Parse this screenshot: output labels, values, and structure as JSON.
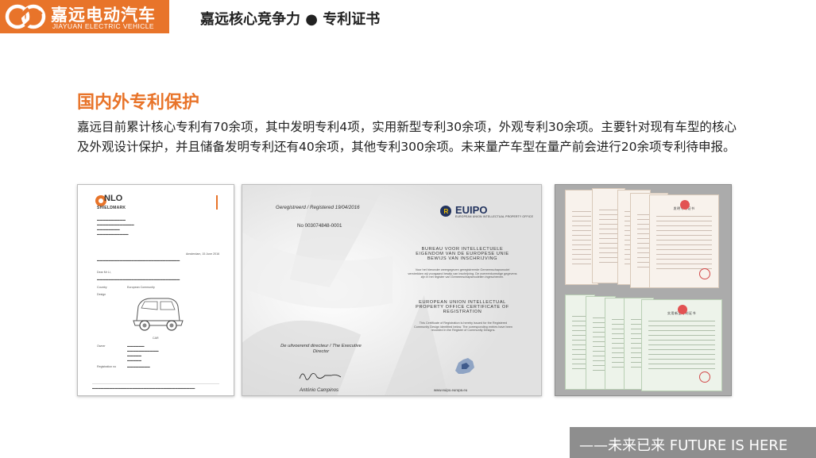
{
  "header": {
    "brand_cn": "嘉远电动汽车",
    "brand_en": "JIAYUAN ELECTRIC VEHICLE",
    "title": "嘉远核心竞争力  ●  专利证书",
    "brand_color": "#e8742a"
  },
  "section": {
    "title": "国内外专利保护",
    "body": "嘉远目前累计核心专利有70余项，其中发明专利4项，实用新型专利30余项，外观专利30余项。主要针对现有车型的核心及外观设计保护，并且储备发明专利还有40余项，其他专利300余项。未来量产车型在量产前会进行20余项专利待申报。"
  },
  "certificates": {
    "nlo": {
      "logo": "NLO",
      "logo_sub": "SHIELDMARK",
      "car_label": "CAR",
      "country_label": "Country",
      "country_value": "European Community",
      "design_label": "Design",
      "owner_label": "Owner",
      "registration_label": "Registration no",
      "date_line": "Amsterdam, 15 June 2016",
      "dear": "Dear Mr Li,"
    },
    "euipo": {
      "logo": "EUIPO",
      "logo_sub": "EUROPEAN UNION INTELLECTUAL PROPERTY OFFICE",
      "registered": "Geregistreerd / Registered 19/04/2016",
      "number": "No 003074848-0001",
      "bureau": "BUREAU VOOR INTELLECTUELE EIGENDOM VAN DE EUROPESE UNIE BEWIJS VAN INSCHRIJVING",
      "bureau_desc": "Voor het hieronder weergegeven geregistreerde Gemeenschapsmodel verstrekken wij voorgaand bewijs van inschrijving. De overeenkomstige gegevens zijn in het register van Gemeenschapsmodellen ingeschreven.",
      "office": "EUROPEAN UNION INTELLECTUAL PROPERTY OFFICE CERTIFICATE OF REGISTRATION",
      "office_desc": "This Certificate of Registration is hereby issued for the Registered Community Design identified below. The corresponding entries have been recorded in the Register of Community Designs.",
      "director": "De uitvoerend directeur / The Executive Director",
      "signer": "António Campinos",
      "url": "www.euipo.europa.eu"
    },
    "cn_patents": {
      "invention_title": "发明专利证书",
      "utility_title": "实用新型专利证书"
    }
  },
  "footer": {
    "slogan": "——未来已来 FUTURE IS HERE"
  }
}
